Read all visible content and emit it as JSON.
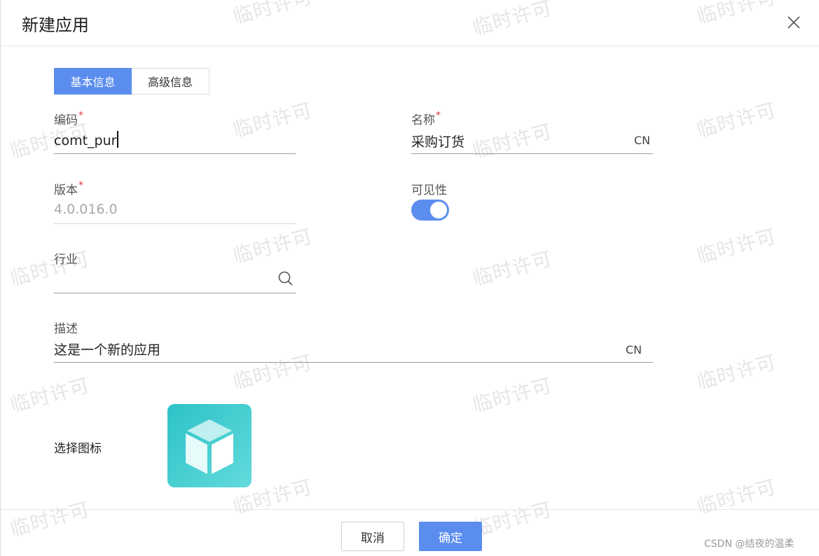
{
  "dialog": {
    "title": "新建应用"
  },
  "tabs": [
    {
      "label": "基本信息",
      "active": true
    },
    {
      "label": "高级信息",
      "active": false
    }
  ],
  "form": {
    "code": {
      "label": "编码",
      "required_mark": "*",
      "value": "comt_pur"
    },
    "name": {
      "label": "名称",
      "required_mark": "*",
      "value": "采购订货",
      "lang_suffix": "CN"
    },
    "version": {
      "label": "版本",
      "required_mark": "*",
      "value": "4.0.016.0"
    },
    "visibility": {
      "label": "可见性",
      "enabled": true
    },
    "industry": {
      "label": "行业",
      "value": ""
    },
    "description": {
      "label": "描述",
      "value": "这是一个新的应用",
      "lang_suffix": "CN"
    },
    "icon": {
      "label": "选择图标",
      "icon_name": "cube-icon"
    }
  },
  "footer": {
    "cancel_label": "取消",
    "ok_label": "确定"
  },
  "watermark_text": "临时许可",
  "corner_mark": "CSDN @结夜的温柔",
  "colors": {
    "accent": "#5b8def",
    "required": "#e23b3b",
    "icon_bg": "#2cc3c6"
  }
}
